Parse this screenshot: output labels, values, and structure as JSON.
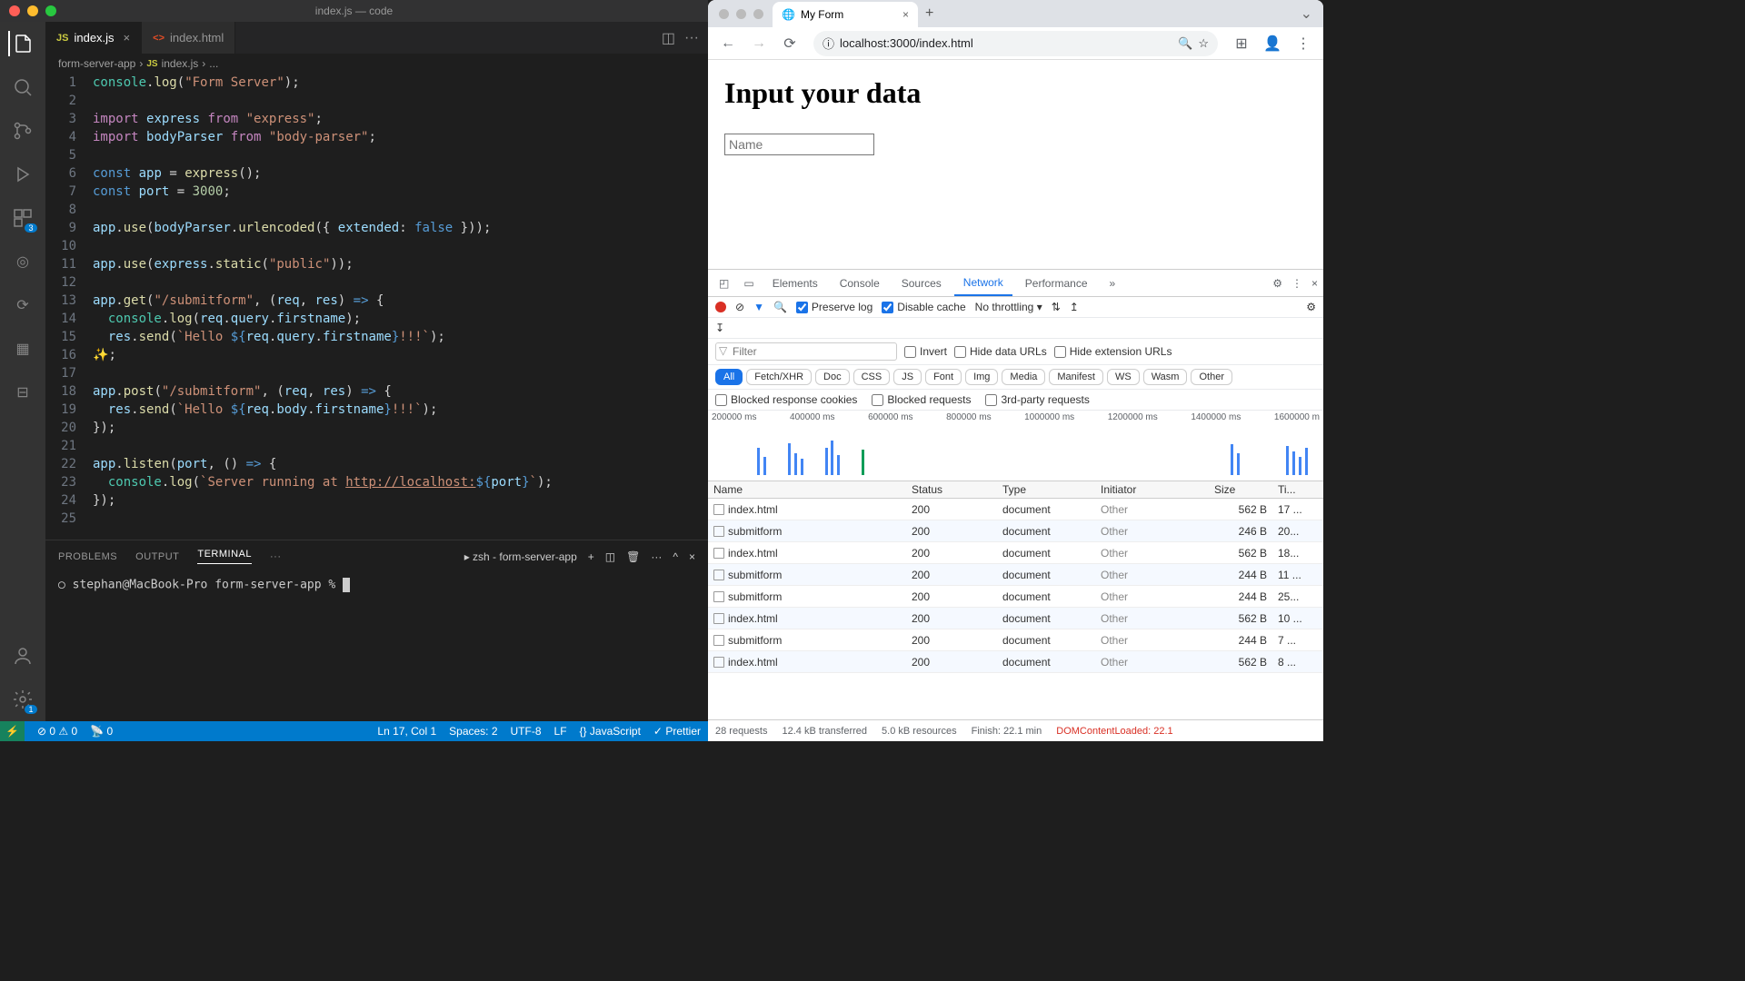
{
  "vscode": {
    "window_title": "index.js — code",
    "tabs": [
      {
        "icon": "JS",
        "label": "index.js",
        "active": true
      },
      {
        "icon": "<>",
        "label": "index.html",
        "active": false
      }
    ],
    "breadcrumb": [
      "form-server-app",
      "index.js",
      "..."
    ],
    "badge_sc": "3",
    "line_numbers": [
      "1",
      "2",
      "3",
      "4",
      "5",
      "6",
      "7",
      "8",
      "9",
      "10",
      "11",
      "12",
      "13",
      "14",
      "15",
      "16",
      "17",
      "18",
      "19",
      "20",
      "21",
      "22",
      "23",
      "24",
      "25"
    ],
    "panel_tabs": [
      "PROBLEMS",
      "OUTPUT",
      "TERMINAL",
      "···"
    ],
    "panel_active": "TERMINAL",
    "terminal_label": "zsh - form-server-app",
    "terminal_prompt": "stephan@MacBook-Pro form-server-app % ",
    "status": {
      "errors": "0",
      "warnings": "0",
      "ports": "0",
      "line_col": "Ln 17, Col 1",
      "spaces": "Spaces: 2",
      "encoding": "UTF-8",
      "eol": "LF",
      "lang": "JavaScript",
      "prettier": "Prettier"
    },
    "settings_badge": "1"
  },
  "browser": {
    "tab_title": "My Form",
    "url": "localhost:3000/index.html",
    "page": {
      "heading": "Input your data",
      "input_placeholder": "Name"
    }
  },
  "devtools": {
    "tabs": [
      "Elements",
      "Console",
      "Sources",
      "Network",
      "Performance"
    ],
    "active_tab": "Network",
    "preserve_log": "Preserve log",
    "disable_cache": "Disable cache",
    "throttling": "No throttling",
    "filter_placeholder": "Filter",
    "filter_checks": [
      "Invert",
      "Hide data URLs",
      "Hide extension URLs"
    ],
    "chips": [
      "All",
      "Fetch/XHR",
      "Doc",
      "CSS",
      "JS",
      "Font",
      "Img",
      "Media",
      "Manifest",
      "WS",
      "Wasm",
      "Other"
    ],
    "extra_checks": [
      "Blocked response cookies",
      "Blocked requests",
      "3rd-party requests"
    ],
    "timeline_ticks": [
      "200000 ms",
      "400000 ms",
      "600000 ms",
      "800000 ms",
      "1000000 ms",
      "1200000 ms",
      "1400000 ms",
      "1600000 m"
    ],
    "columns": [
      "Name",
      "Status",
      "Type",
      "Initiator",
      "Size",
      "Ti..."
    ],
    "requests": [
      {
        "name": "index.html",
        "status": "200",
        "type": "document",
        "initiator": "Other",
        "size": "562 B",
        "time": "17 ..."
      },
      {
        "name": "submitform",
        "status": "200",
        "type": "document",
        "initiator": "Other",
        "size": "246 B",
        "time": "20..."
      },
      {
        "name": "index.html",
        "status": "200",
        "type": "document",
        "initiator": "Other",
        "size": "562 B",
        "time": "18..."
      },
      {
        "name": "submitform",
        "status": "200",
        "type": "document",
        "initiator": "Other",
        "size": "244 B",
        "time": "11 ..."
      },
      {
        "name": "submitform",
        "status": "200",
        "type": "document",
        "initiator": "Other",
        "size": "244 B",
        "time": "25..."
      },
      {
        "name": "index.html",
        "status": "200",
        "type": "document",
        "initiator": "Other",
        "size": "562 B",
        "time": "10 ..."
      },
      {
        "name": "submitform",
        "status": "200",
        "type": "document",
        "initiator": "Other",
        "size": "244 B",
        "time": "7 ..."
      },
      {
        "name": "index.html",
        "status": "200",
        "type": "document",
        "initiator": "Other",
        "size": "562 B",
        "time": "8 ..."
      }
    ],
    "summary": {
      "requests": "28 requests",
      "transferred": "12.4 kB transferred",
      "resources": "5.0 kB resources",
      "finish": "Finish: 22.1 min",
      "dcl": "DOMContentLoaded: 22.1"
    }
  }
}
